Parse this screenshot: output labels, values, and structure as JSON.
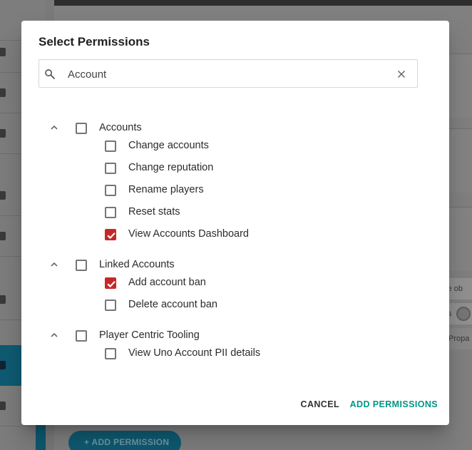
{
  "background": {
    "chips": [
      "lete ob",
      "s",
      "Propa"
    ],
    "add_button_label": "+ ADD PERMISSION"
  },
  "dialog": {
    "title": "Select Permissions",
    "search": {
      "value": "Account",
      "icon": "search-icon",
      "clear_icon": "close-icon"
    },
    "groups": [
      {
        "label": "Accounts",
        "expanded": true,
        "checked": false,
        "items": [
          {
            "label": "Change accounts",
            "checked": false
          },
          {
            "label": "Change reputation",
            "checked": false
          },
          {
            "label": "Rename players",
            "checked": false
          },
          {
            "label": "Reset stats",
            "checked": false
          },
          {
            "label": "View Accounts Dashboard",
            "checked": true
          }
        ]
      },
      {
        "label": "Linked Accounts",
        "expanded": true,
        "checked": false,
        "items": [
          {
            "label": "Add account ban",
            "checked": true
          },
          {
            "label": "Delete account ban",
            "checked": false
          }
        ]
      },
      {
        "label": "Player Centric Tooling",
        "expanded": true,
        "checked": false,
        "items": [
          {
            "label": "View Uno Account PII details",
            "checked": false
          }
        ]
      }
    ],
    "actions": {
      "cancel_label": "CANCEL",
      "confirm_label": "ADD PERMISSIONS"
    }
  },
  "colors": {
    "accent": "#009688",
    "checked": "#c62828",
    "sidebar_active": "#0f5b73"
  }
}
